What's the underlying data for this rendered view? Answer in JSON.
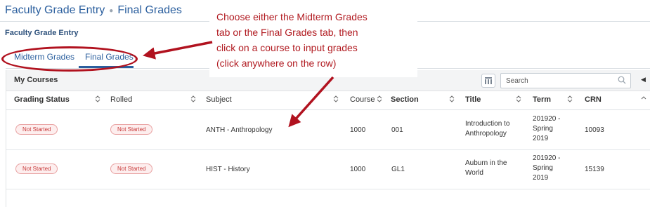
{
  "breadcrumb": {
    "parent": "Faculty Grade Entry",
    "current": "Final Grades"
  },
  "page_subtitle": "Faculty Grade Entry",
  "tabs": [
    {
      "label": "Midterm Grades",
      "selected": false
    },
    {
      "label": "Final Grades",
      "selected": true
    }
  ],
  "courses": {
    "title": "My Courses",
    "grid_icon": "grid-icon",
    "search_placeholder": "Search",
    "search_icon": "search-icon"
  },
  "table": {
    "headers": [
      "Grading Status",
      "Rolled",
      "Subject",
      "Course",
      "Section",
      "Title",
      "Term",
      "CRN"
    ],
    "rows": [
      {
        "grading_status": "Not Started",
        "rolled": "Not Started",
        "subject": "ANTH - Anthropology",
        "course": "1000",
        "section": "001",
        "title_line1": "Introduction to",
        "title_line2": "Anthropology",
        "term_line1": "201920 -",
        "term_line2": "Spring",
        "term_line3": "2019",
        "crn": "10093"
      },
      {
        "grading_status": "Not Started",
        "rolled": "Not Started",
        "subject": "HIST - History",
        "course": "1000",
        "section": "GL1",
        "title_line1": "Auburn in the",
        "title_line2": "World",
        "term_line1": "201920 -",
        "term_line2": "Spring",
        "term_line3": "2019",
        "crn": "15139"
      }
    ]
  },
  "annotation": {
    "line1": "Choose either the Midterm Grades",
    "line2": "tab or the Final Grades tab, then",
    "line3": "click on a course to input grades",
    "line4": "(click anywhere on the row)",
    "color": "#b1121f"
  },
  "colors": {
    "brand": "#2b5f9e",
    "status_bg": "#fdeeee",
    "status_text": "#c83a3a"
  }
}
